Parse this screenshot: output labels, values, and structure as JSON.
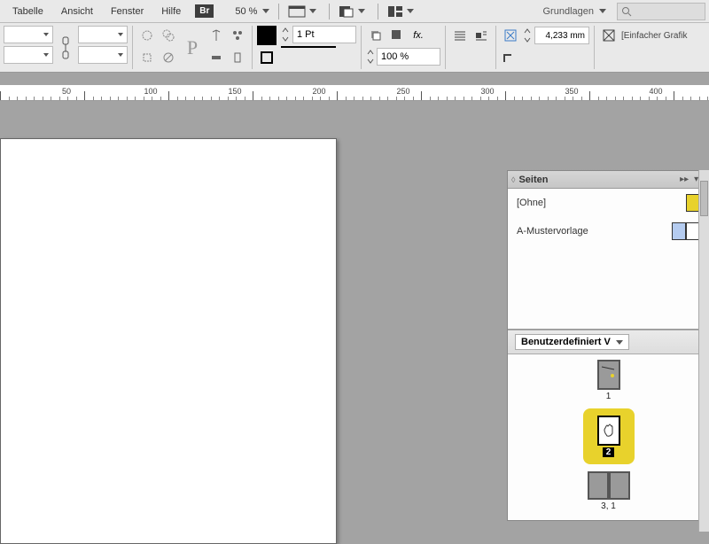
{
  "menu": {
    "items": [
      "Tabelle",
      "Ansicht",
      "Fenster",
      "Hilfe"
    ],
    "br": "Br",
    "zoom": "50 %"
  },
  "workspace": {
    "label": "Grundlagen"
  },
  "toolbar": {
    "stroke_weight": "1 Pt",
    "opacity": "100 %",
    "size_field": "4,233 mm",
    "graphic_frame": "[Einfacher Grafik"
  },
  "ruler": {
    "labels": [
      "50",
      "100",
      "150",
      "200",
      "250",
      "300",
      "350",
      "400"
    ]
  },
  "panel": {
    "title": "Seiten",
    "masters": [
      {
        "label": "[Ohne]",
        "thumbs": [
          "yellow"
        ]
      },
      {
        "label": "A-Mustervorlage",
        "thumbs": [
          "blue",
          "white"
        ]
      }
    ],
    "section": "Benutzerdefiniert V",
    "pages": [
      {
        "label": "1",
        "type": "single-gray"
      },
      {
        "label": "2",
        "type": "selected"
      },
      {
        "label": "3, 1",
        "type": "spread-gray"
      }
    ]
  }
}
